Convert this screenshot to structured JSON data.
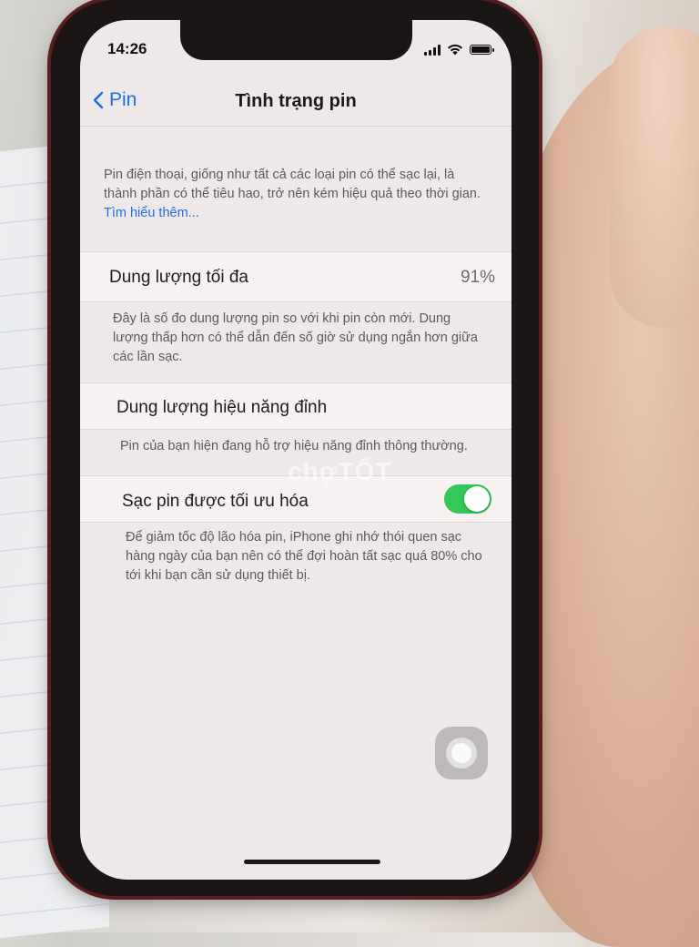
{
  "status_bar": {
    "time": "14:26"
  },
  "nav": {
    "back_label": "Pin",
    "title": "Tình trạng pin"
  },
  "intro": {
    "text": "Pin điện thoại, giống như tất cả các loại pin có thể sạc lại, là thành phần có thể tiêu hao, trở nên kém hiệu quả theo thời gian.",
    "link": "Tìm hiểu thêm..."
  },
  "max_capacity": {
    "label": "Dung lượng tối đa",
    "value": "91%",
    "description": "Đây là số đo dung lượng pin so với khi pin còn mới. Dung lượng thấp hơn có thể dẫn đến số giờ sử dụng ngắn hơn giữa các lần sạc."
  },
  "peak_performance": {
    "label": "Dung lượng hiệu năng đỉnh",
    "description": "Pin của bạn hiện đang hỗ trợ hiệu năng đỉnh thông thường."
  },
  "optimized_charging": {
    "label": "Sạc pin được tối ưu hóa",
    "enabled": true,
    "description": "Để giảm tốc độ lão hóa pin, iPhone ghi nhớ thói quen sạc hàng ngày của bạn nên có thể đợi hoàn tất sạc quá 80% cho tới khi bạn cần sử dụng thiết bị."
  },
  "watermark": "chợTỐT",
  "colors": {
    "accent": "#1d6fe0",
    "toggle_on": "#34c759"
  },
  "icons": [
    "chevron-left-icon",
    "signal-icon",
    "wifi-icon",
    "battery-icon",
    "assistive-touch-icon"
  ]
}
